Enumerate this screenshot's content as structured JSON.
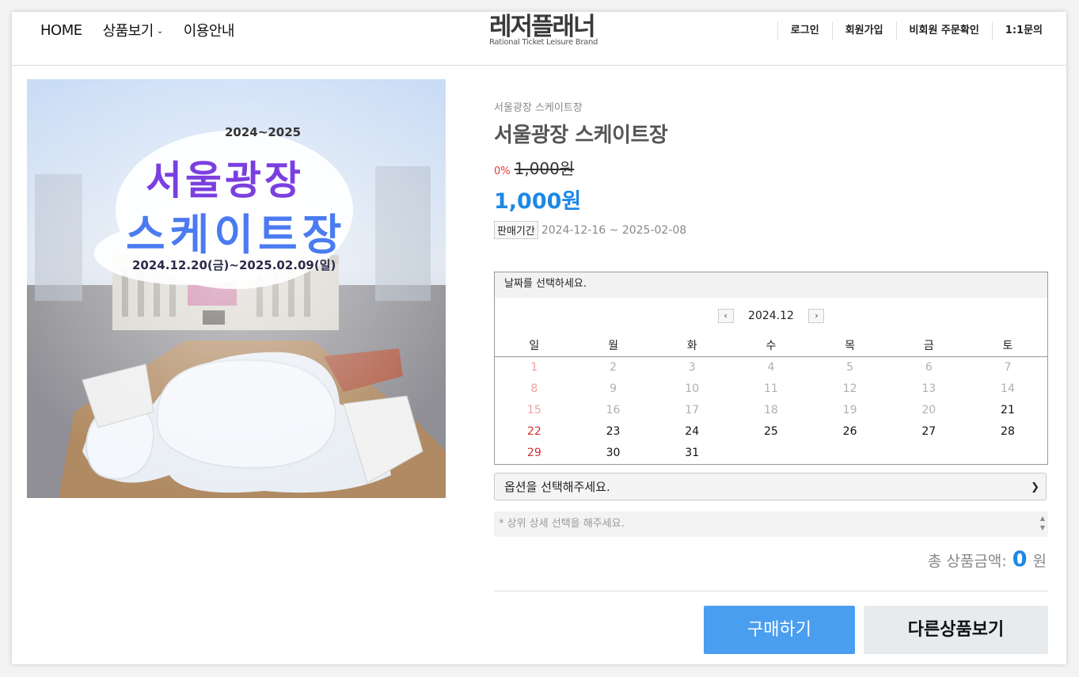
{
  "nav": {
    "home": "HOME",
    "products": "상품보기",
    "guide": "이용안내",
    "login": "로그인",
    "signup": "회원가입",
    "guest_order": "비회원 주문확인",
    "inquiry": "1:1문의"
  },
  "logo": {
    "name": "레저플래너",
    "tagline": "Rational Ticket Leisure Brand"
  },
  "poster": {
    "years": "2024~2025",
    "line1": "서울광장",
    "line2": "스케이트장",
    "dates": "2024.12.20(금)~2025.02.09(일)"
  },
  "product": {
    "breadcrumb": "서울광장 스케이트장",
    "title": "서울광장 스케이트장",
    "discount": "0%",
    "original_price": "1,000원",
    "sale_price": "1,000원",
    "period_label": "판매기간",
    "period": "2024-12-16 ~ 2025-02-08"
  },
  "calendar": {
    "prompt": "날짜를 선택하세요.",
    "month": "2024.12",
    "weekdays": [
      "일",
      "월",
      "화",
      "수",
      "목",
      "금",
      "토"
    ],
    "weeks": [
      [
        "1",
        "2",
        "3",
        "4",
        "5",
        "6",
        "7"
      ],
      [
        "8",
        "9",
        "10",
        "11",
        "12",
        "13",
        "14"
      ],
      [
        "15",
        "16",
        "17",
        "18",
        "19",
        "20",
        "21"
      ],
      [
        "22",
        "23",
        "24",
        "25",
        "26",
        "27",
        "28"
      ],
      [
        "29",
        "30",
        "31",
        "",
        "",
        "",
        ""
      ]
    ],
    "first_available_day": 21
  },
  "option": {
    "placeholder": "옵션을 선택해주세요."
  },
  "memo": {
    "placeholder": "* 상위 상세 선택을 해주세요."
  },
  "total": {
    "label": "총 상품금액:",
    "value": "0",
    "unit": "원"
  },
  "buttons": {
    "buy": "구매하기",
    "other": "다른상품보기"
  },
  "colors": {
    "accent": "#1e88e5",
    "buy_button": "#4a9ef0",
    "discount": "#e53935",
    "sunday": "#d32f2f"
  }
}
